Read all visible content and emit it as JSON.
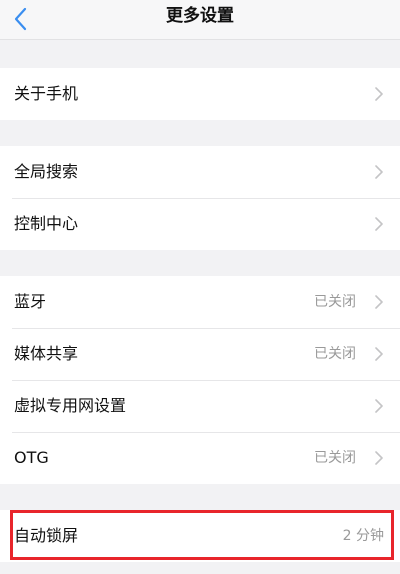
{
  "header": {
    "back_icon": "chevron-left-icon",
    "title": "更多设置"
  },
  "colors": {
    "accent": "#3a8ef0",
    "highlight_border": "#e8252b",
    "value_text": "#9a9a9a"
  },
  "groups": [
    {
      "items": [
        {
          "label": "关于手机",
          "value": ""
        }
      ]
    },
    {
      "items": [
        {
          "label": "全局搜索",
          "value": ""
        },
        {
          "label": "控制中心",
          "value": ""
        }
      ]
    },
    {
      "items": [
        {
          "label": "蓝牙",
          "value": "已关闭"
        },
        {
          "label": "媒体共享",
          "value": "已关闭"
        },
        {
          "label": "虚拟专用网设置",
          "value": ""
        },
        {
          "label": "OTG",
          "value": "已关闭"
        }
      ]
    },
    {
      "items": [
        {
          "label": "自动锁屏",
          "value": "2 分钟"
        }
      ]
    }
  ]
}
